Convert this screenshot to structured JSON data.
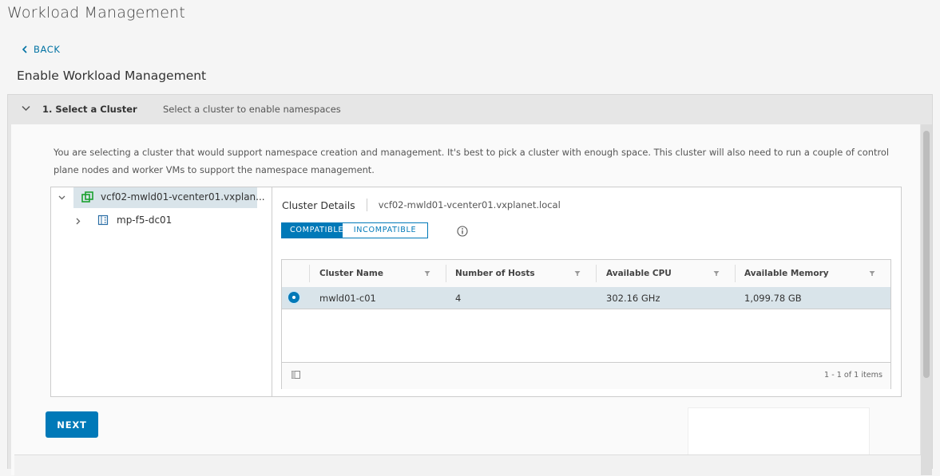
{
  "page": {
    "title": "Workload Management"
  },
  "nav": {
    "back_label": "BACK"
  },
  "wizard": {
    "title": "Enable Workload Management",
    "step": {
      "label": "1. Select a Cluster",
      "description": "Select a cluster to enable namespaces"
    },
    "intro": "You are selecting a cluster that would support namespace creation and management. It's best to pick a cluster with enough space. This cluster will also need to run a couple of control plane nodes and worker VMs to support the namespace management.",
    "next_label": "NEXT"
  },
  "tree": {
    "items": [
      {
        "label": "vcf02-mwld01-vcenter01.vxplan...",
        "icon": "vcenter-icon",
        "expanded": true,
        "selected": true
      },
      {
        "label": "mp-f5-dc01",
        "icon": "datacenter-icon",
        "expanded": false,
        "selected": false
      }
    ]
  },
  "details": {
    "title": "Cluster Details",
    "host": "vcf02-mwld01-vcenter01.vxplanet.local",
    "tabs": {
      "compatible": "COMPATIBLE",
      "incompatible": "INCOMPATIBLE"
    },
    "active_tab": "compatible",
    "grid": {
      "columns": [
        "Cluster Name",
        "Number of Hosts",
        "Available CPU",
        "Available Memory"
      ],
      "rows": [
        {
          "selected": true,
          "cluster_name": "mwld01-c01",
          "hosts": "4",
          "cpu": "302.16 GHz",
          "memory": "1,099.78 GB"
        }
      ],
      "pagination": "1 - 1 of 1 items"
    }
  },
  "colors": {
    "accent": "#0079b8",
    "selection": "#d9e4ea",
    "vcenter_icon": "#1aa12e",
    "link": "#0072a3"
  }
}
